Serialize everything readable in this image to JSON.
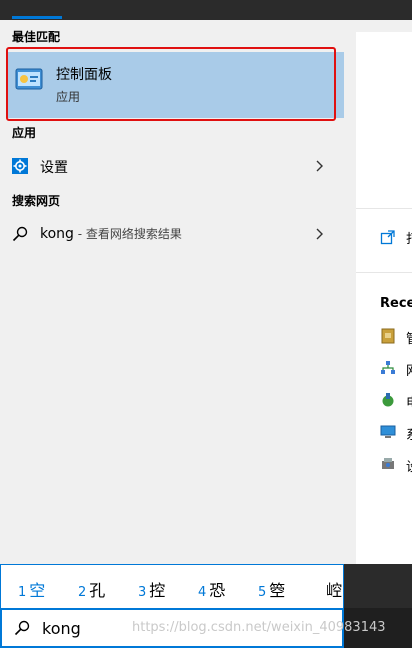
{
  "best_match": {
    "heading": "最佳匹配",
    "title": "控制面板",
    "subtitle": "应用"
  },
  "apps": {
    "heading": "应用",
    "settings_label": "设置"
  },
  "web": {
    "heading": "搜索网页",
    "query": "kong",
    "hint": " - 查看网络搜索结果"
  },
  "right_panel": {
    "recent_heading": "Recei",
    "open_char": "打",
    "recent_chars": [
      "管",
      "网",
      "电",
      "系",
      "设"
    ]
  },
  "ime": {
    "candidates": [
      {
        "num": "1",
        "ch": "空"
      },
      {
        "num": "2",
        "ch": "孔"
      },
      {
        "num": "3",
        "ch": "控"
      },
      {
        "num": "4",
        "ch": "恐"
      },
      {
        "num": "5",
        "ch": "箜"
      },
      {
        "num": "",
        "ch": "崆"
      }
    ]
  },
  "search": {
    "value": "kong"
  },
  "watermark": "https://blog.csdn.net/weixin_40983143 ",
  "colors": {
    "accent": "#0078d7",
    "highlight": "#a9cbe8",
    "annotation": "#e01010"
  }
}
